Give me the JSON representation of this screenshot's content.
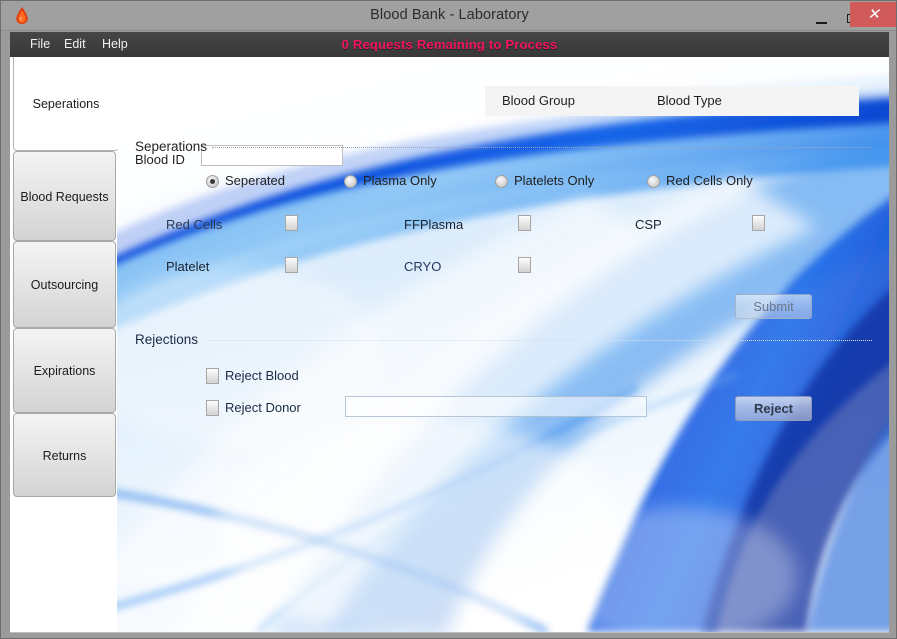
{
  "window": {
    "title": "Blood Bank - Laboratory",
    "icon": "blood-drop-icon",
    "controls": {
      "minimize": "–",
      "maximize": "□",
      "close": "✕"
    },
    "close_color": "#d15b5b"
  },
  "menu": {
    "items": [
      {
        "label": "File"
      },
      {
        "label": "Edit"
      },
      {
        "label": "Help"
      }
    ],
    "banner": {
      "text": "0 Requests Remaining to Process",
      "color": "#f4145f"
    }
  },
  "sidebar": {
    "items": [
      {
        "label": "Seperations",
        "active": true
      },
      {
        "label": "Blood Requests",
        "active": false
      },
      {
        "label": "Outsourcing",
        "active": false
      },
      {
        "label": "Expirations",
        "active": false
      },
      {
        "label": "Returns",
        "active": false
      }
    ]
  },
  "main": {
    "blood_id": {
      "label": "Blood ID",
      "value": "",
      "placeholder": ""
    },
    "blood_info": {
      "columns": [
        {
          "label": "Blood Group"
        },
        {
          "label": "Blood Type"
        }
      ]
    },
    "seperations": {
      "header": "Seperations",
      "radios": [
        {
          "label": "Seperated",
          "checked": true
        },
        {
          "label": "Plasma Only",
          "checked": false
        },
        {
          "label": "Platelets Only",
          "checked": false
        },
        {
          "label": "Red Cells Only",
          "checked": false
        }
      ],
      "components": [
        {
          "label": "Red Cells",
          "checked": false
        },
        {
          "label": "FFPlasma",
          "checked": false
        },
        {
          "label": "CSP",
          "checked": false
        },
        {
          "label": "Platelet",
          "checked": false
        },
        {
          "label": "CRYO",
          "checked": false
        }
      ],
      "submit_label": "Submit"
    },
    "rejections": {
      "header": "Rejections",
      "checkboxes": [
        {
          "label": "Reject Blood",
          "checked": false
        },
        {
          "label": "Reject Donor",
          "checked": false
        }
      ],
      "reason": {
        "value": "",
        "placeholder": ""
      },
      "reject_label": "Reject"
    }
  }
}
